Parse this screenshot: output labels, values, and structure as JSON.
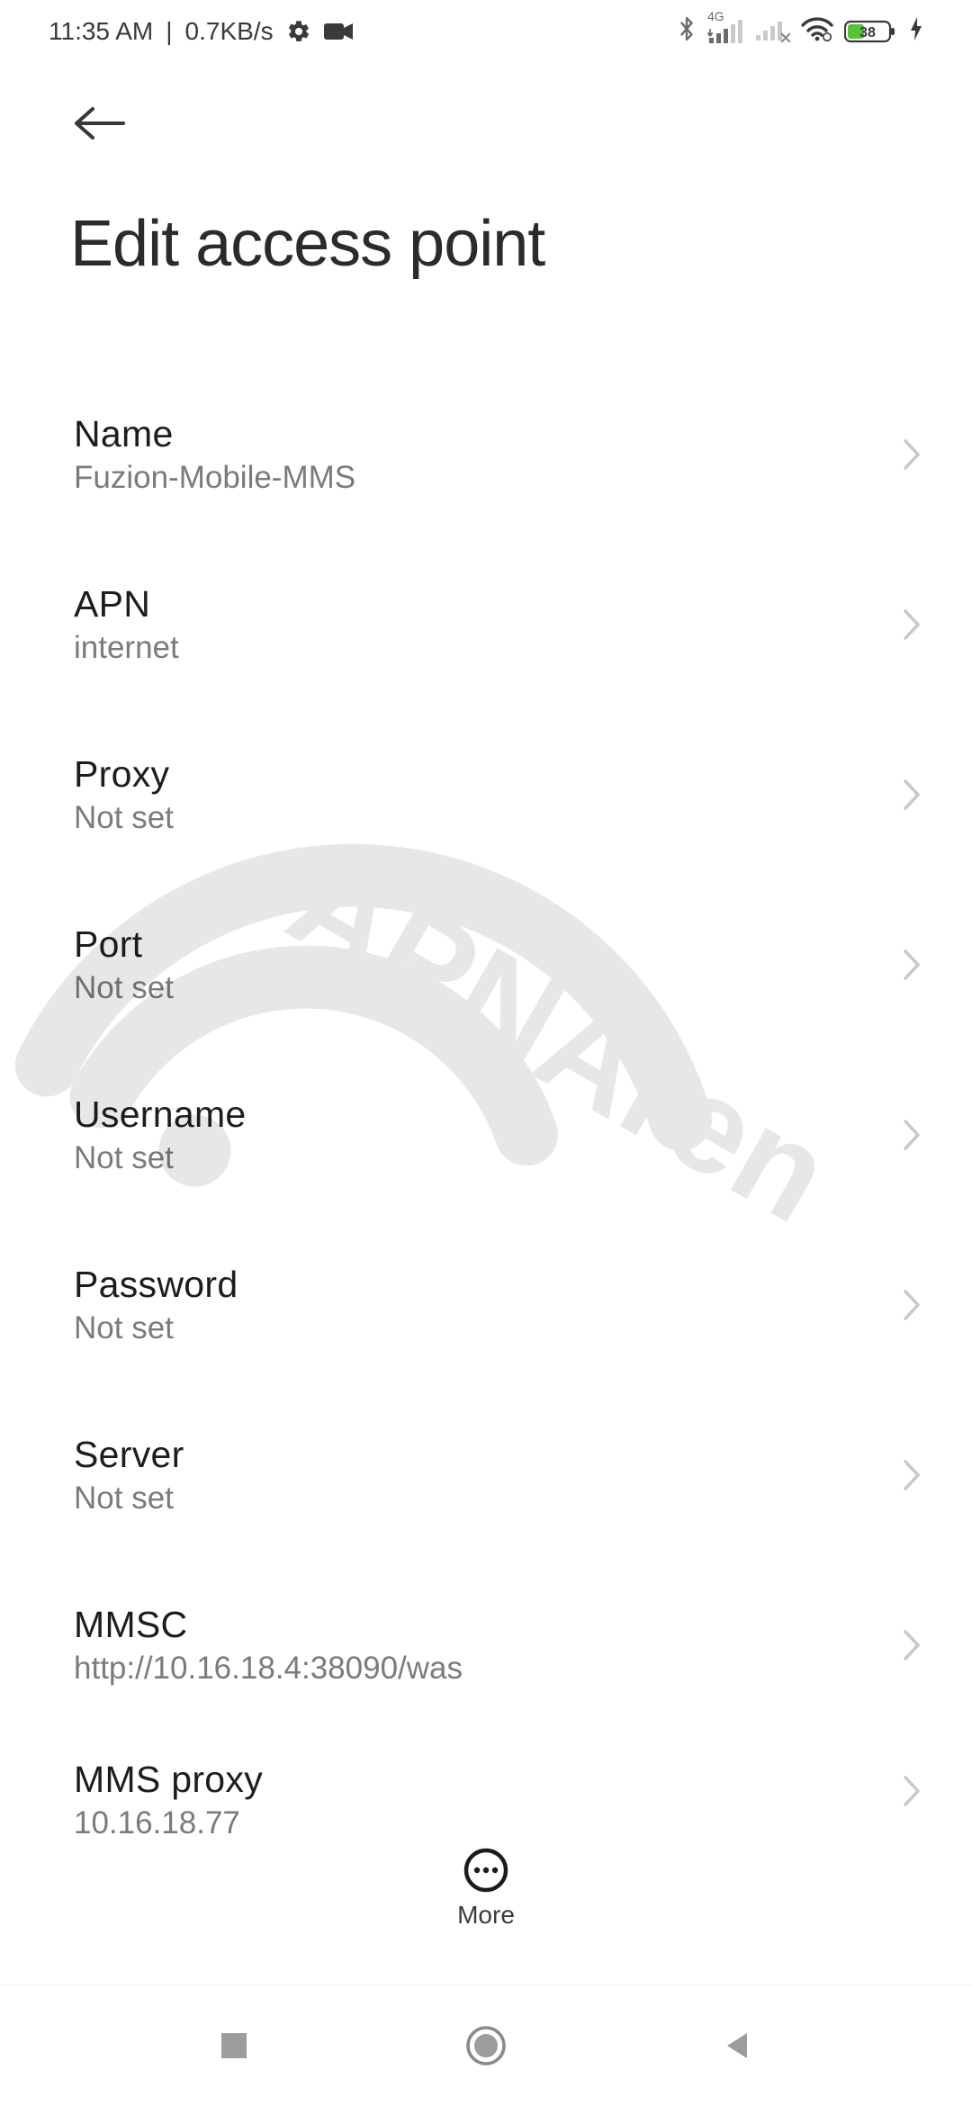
{
  "status": {
    "time": "11:35 AM",
    "separator": "|",
    "net_speed": "0.7KB/s",
    "battery_pct": "38",
    "network_label": "4G"
  },
  "page": {
    "title": "Edit access point"
  },
  "items": [
    {
      "label": "Name",
      "value": "Fuzion-Mobile-MMS"
    },
    {
      "label": "APN",
      "value": "internet"
    },
    {
      "label": "Proxy",
      "value": "Not set"
    },
    {
      "label": "Port",
      "value": "Not set"
    },
    {
      "label": "Username",
      "value": "Not set"
    },
    {
      "label": "Password",
      "value": "Not set"
    },
    {
      "label": "Server",
      "value": "Not set"
    },
    {
      "label": "MMSC",
      "value": "http://10.16.18.4:38090/was"
    },
    {
      "label": "MMS proxy",
      "value": "10.16.18.77"
    }
  ],
  "bottom": {
    "more_label": "More"
  },
  "watermark": {
    "text": "APNArena"
  }
}
